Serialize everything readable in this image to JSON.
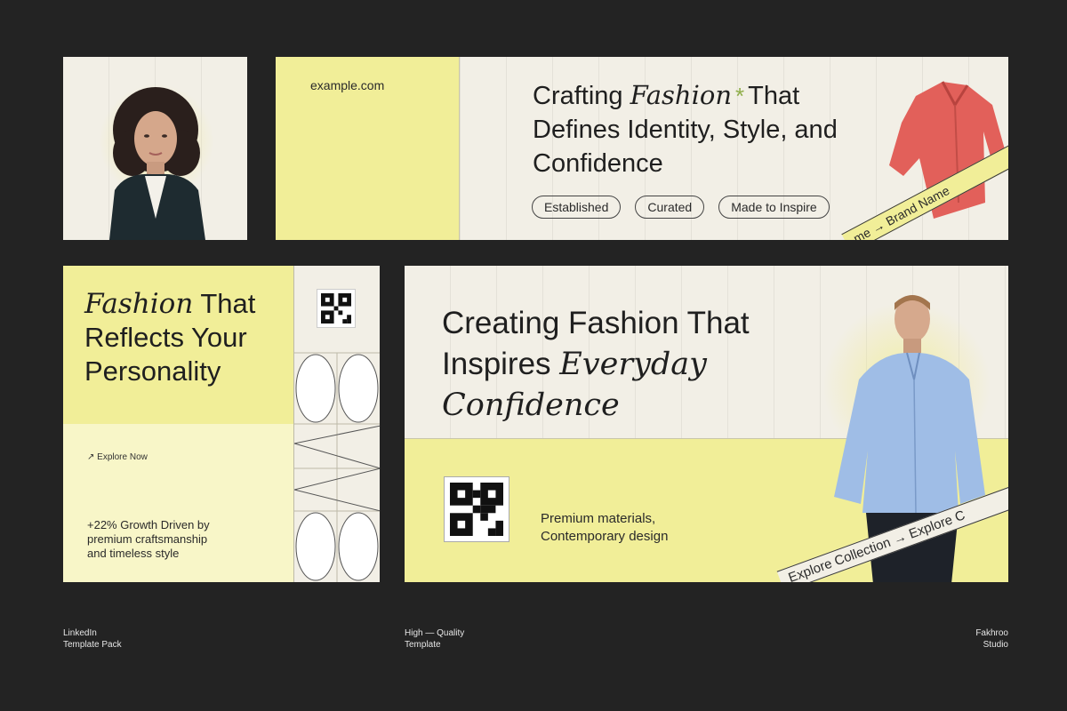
{
  "colors": {
    "background": "#232323",
    "yellow": "#f1ee98",
    "pale_yellow": "#f8f6c8",
    "cream": "#f2efe6",
    "asterisk_green": "#8fae4a",
    "shirt_red": "#e2605a",
    "shirt_blue": "#9fbde6"
  },
  "banner": {
    "url": "example.com",
    "headline_line1_a": "Crafting",
    "headline_line1_b": "Fashion",
    "headline_asterisk": "*",
    "headline_line1_c": "That",
    "headline_line2": "Defines Identity, Style, and",
    "headline_line3": "Confidence",
    "pills": [
      "Established",
      "Curated",
      "Made to Inspire"
    ],
    "ribbon_text": "me → Brand Name",
    "shirt_icon": "red-shirt-icon"
  },
  "profile": {
    "portrait_icon": "woman-portrait-icon"
  },
  "square": {
    "heading_italic": "Fashion",
    "heading_rest1": " That",
    "heading_line2": "Reflects Your",
    "heading_line3": "Personality",
    "explore_arrow": "↗",
    "explore_label": "Explore Now",
    "growth_line1": "+22% Growth Driven by",
    "growth_line2": "premium craftsmanship",
    "growth_line3": "and timeless style"
  },
  "wide": {
    "headline_line1": "Creating Fashion That",
    "headline_line2_a": "Inspires",
    "headline_line2_b": "Everyday Confidence",
    "materials_line1": "Premium materials,",
    "materials_line2": "Contemporary design",
    "ribbon_text": "Explore Collection  →  Explore C",
    "model_icon": "man-blue-shirt-portrait-icon"
  },
  "footer": {
    "left_line1": "LinkedIn",
    "left_line2": "Template Pack",
    "center_line1": "High — Quality",
    "center_line2": "Template",
    "right_line1": "Fakhroo",
    "right_line2": "Studio"
  }
}
